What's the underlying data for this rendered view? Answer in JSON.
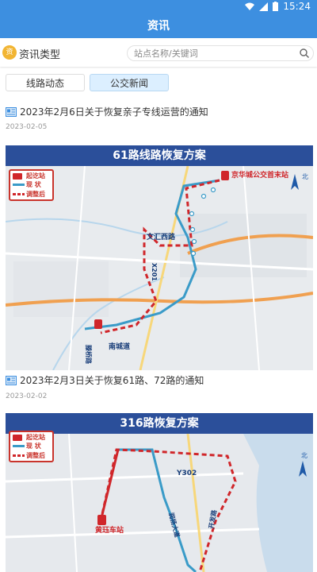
{
  "status_bar": {
    "time": "15:24"
  },
  "app_bar": {
    "title": "资讯"
  },
  "filter": {
    "type_badge": "资",
    "type_label": "资讯类型",
    "search_placeholder": "站点名称/关键词"
  },
  "tabs": [
    {
      "label": "线路动态",
      "selected": false
    },
    {
      "label": "公交新闻",
      "selected": true
    }
  ],
  "news": [
    {
      "title": "2023年2月6日关于恢复亲子专线运营的通知",
      "date": "2023-02-05",
      "card_title": "61路线路恢复方案",
      "map_labels": {
        "terminal": "京华城公交首末站",
        "road_a": "文汇西路",
        "road_b": "X201",
        "road_c": "南城道",
        "road_d": "滕桥路",
        "north": "北"
      }
    },
    {
      "title": "2023年2月3日关于恢复61路、72路的通知",
      "date": "2023-02-02",
      "card_title": "316路恢复方案",
      "map_labels": {
        "terminal": "黄珏车站",
        "road_a": "Y302",
        "road_b": "润扬大道",
        "road_c": "开发路",
        "north": "北"
      }
    }
  ],
  "legend": {
    "start_station": "起讫站",
    "current": "现  状",
    "adjusted": "调整后"
  },
  "colors": {
    "app_bar": "#3d8fe0",
    "card_header": "#2b4f9a",
    "route_current": "#3a9bc8",
    "route_adjusted": "#d0262a"
  }
}
